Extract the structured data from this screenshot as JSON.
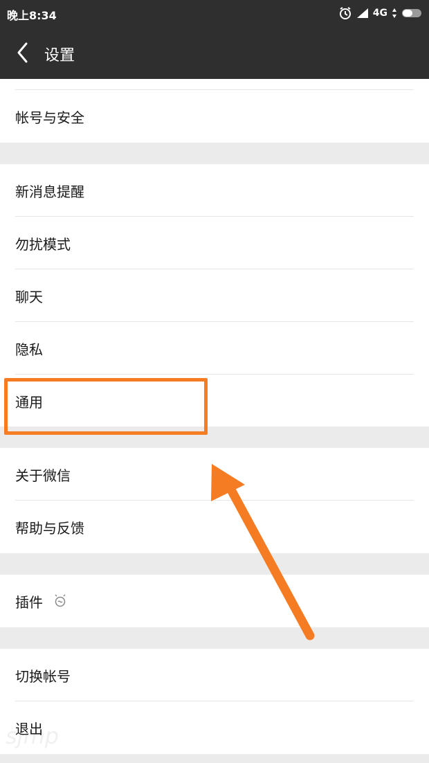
{
  "status_bar": {
    "time": "晚上8:34",
    "network": "4G",
    "icons": [
      "alarm-icon",
      "signal-icon",
      "data-arrows-icon",
      "battery-icon"
    ]
  },
  "nav": {
    "back_icon": "chevron-left-icon",
    "title": "设置"
  },
  "settings": {
    "account_security": "帐号与安全",
    "new_message_alerts": "新消息提醒",
    "do_not_disturb": "勿扰模式",
    "chat": "聊天",
    "privacy": "隐私",
    "general": "通用",
    "about": "关于微信",
    "help_feedback": "帮助与反馈",
    "plugins": "插件",
    "switch_account": "切换帐号",
    "logout": "退出"
  },
  "annotation": {
    "color": "#f57c23",
    "highlighted_item": "通用"
  },
  "watermark": "sjmp"
}
